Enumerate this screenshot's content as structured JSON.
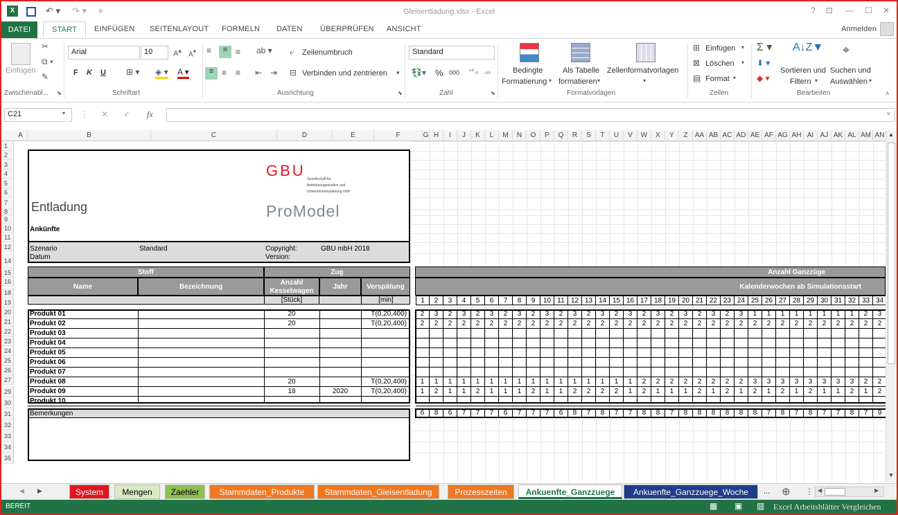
{
  "window": {
    "title": "Gleisentladung.xlsx - Excel",
    "help": "?",
    "min": "—",
    "max": "☐",
    "close": "✕"
  },
  "ribbon_tabs": [
    "DATEI",
    "START",
    "EINFÜGEN",
    "SEITENLAYOUT",
    "FORMELN",
    "DATEN",
    "ÜBERPRÜFEN",
    "ANSICHT"
  ],
  "signin": "Anmelden",
  "ribbon": {
    "clipboard": {
      "paste": "Einfügen",
      "group": "Zwischenabl..."
    },
    "font": {
      "name": "Arial",
      "size": "10",
      "bold": "F",
      "italic": "K",
      "underline": "U",
      "group": "Schriftart"
    },
    "alignment": {
      "wrap": "Zeilenumbruch",
      "merge": "Verbinden und zentrieren",
      "group": "Ausrichtung"
    },
    "number": {
      "format": "Standard",
      "percent": "%",
      "thousands": "000",
      "group": "Zahl"
    },
    "styles": {
      "conditional_1": "Bedingte",
      "conditional_2": "Formatierung",
      "table_1": "Als Tabelle",
      "table_2": "formatieren",
      "cellstyles": "Zellenformatvorlagen",
      "group": "Formatvorlagen"
    },
    "cells": {
      "insert": "Einfügen",
      "delete": "Löschen",
      "format": "Format",
      "group": "Zellen"
    },
    "editing": {
      "sort_1": "Sortieren und",
      "sort_2": "Filtern",
      "find_1": "Suchen und",
      "find_2": "Auswählen",
      "group": "Bearbeiten"
    }
  },
  "formula_bar": {
    "name_box": "C21",
    "fx": "fx",
    "formula": ""
  },
  "columns": [
    "A",
    "B",
    "C",
    "D",
    "E",
    "F",
    "G",
    "H",
    "I",
    "J",
    "K",
    "L",
    "M",
    "N",
    "O",
    "P",
    "Q",
    "R",
    "S",
    "T",
    "U",
    "V",
    "W",
    "X",
    "Y",
    "Z",
    "AA",
    "AB",
    "AC",
    "AD",
    "AE",
    "AF",
    "AG",
    "AH",
    "AI",
    "AJ",
    "AK",
    "AL",
    "AM",
    "AN",
    "AO"
  ],
  "rows": [
    "1",
    "2",
    "3",
    "4",
    "5",
    "6",
    "7",
    "8",
    "9",
    "10",
    "11",
    "12",
    "14",
    "15",
    "16",
    "18",
    "19",
    "20",
    "21",
    "22",
    "23",
    "24",
    "25",
    "26",
    "27",
    "29",
    "30",
    "31",
    "32",
    "33",
    "34",
    "35"
  ],
  "sheet": {
    "title": "Entladung",
    "subtitle": "Ankünfte",
    "gbu_logo": "GBU",
    "gbu_line1": "Gesellschaft für",
    "gbu_line2": "Betriebsorganisation und",
    "gbu_line3": "Unternehmensplanung mbH",
    "promodel_logo": "ProModel",
    "szenario_label": "Szenario",
    "szenario_value": "Standard",
    "datum_label": "Datum",
    "copyright_label": "Copyright:",
    "copyright_value": "GBU mbH 2018",
    "version_label": "Version:",
    "hdr_stoff": "Stoff",
    "hdr_zug": "Zug",
    "hdr_name": "Name",
    "hdr_bez": "Bezeichnung",
    "hdr_anzahl": "Anzahl Kesselwagen",
    "hdr_jahr": "Jahr",
    "hdr_versp": "Verspätung",
    "unit_stueck": "[Stück]",
    "unit_min": "[min]",
    "hdr_ganz": "Anzahl Ganzzüge",
    "hdr_kw": "Kalenderwochen ab Simulationsstart",
    "bemerkungen": "Bemerkungen"
  },
  "products": [
    {
      "name": "Produkt 01",
      "anzahl": "20",
      "jahr": "",
      "versp": "T(0,20,400)"
    },
    {
      "name": "Produkt 02",
      "anzahl": "20",
      "jahr": "",
      "versp": "T(0,20,400)"
    },
    {
      "name": "Produkt 03",
      "anzahl": "",
      "jahr": "",
      "versp": ""
    },
    {
      "name": "Produkt 04",
      "anzahl": "",
      "jahr": "",
      "versp": ""
    },
    {
      "name": "Produkt 05",
      "anzahl": "",
      "jahr": "",
      "versp": ""
    },
    {
      "name": "Produkt 06",
      "anzahl": "",
      "jahr": "",
      "versp": ""
    },
    {
      "name": "Produkt 07",
      "anzahl": "",
      "jahr": "",
      "versp": ""
    },
    {
      "name": "Produkt 08",
      "anzahl": "20",
      "jahr": "",
      "versp": "T(0,20,400)"
    },
    {
      "name": "Produkt 09",
      "anzahl": "18",
      "jahr": "2020",
      "versp": "T(0,20,400)"
    },
    {
      "name": "Produkt 10",
      "anzahl": "",
      "jahr": "",
      "versp": ""
    }
  ],
  "weeks": [
    "1",
    "2",
    "3",
    "4",
    "5",
    "6",
    "7",
    "8",
    "9",
    "10",
    "11",
    "12",
    "13",
    "14",
    "15",
    "16",
    "17",
    "18",
    "19",
    "20",
    "21",
    "22",
    "23",
    "24",
    "25",
    "26",
    "27",
    "28",
    "29",
    "30",
    "31",
    "32",
    "33",
    "34"
  ],
  "week_values": {
    "p01": [
      "2",
      "3",
      "2",
      "3",
      "2",
      "3",
      "2",
      "3",
      "2",
      "3",
      "2",
      "3",
      "2",
      "3",
      "2",
      "3",
      "2",
      "3",
      "2",
      "3",
      "2",
      "3",
      "2",
      "3",
      "1",
      "1",
      "1",
      "1",
      "1",
      "1",
      "1",
      "1",
      "2",
      "3"
    ],
    "p02": [
      "2",
      "2",
      "2",
      "2",
      "2",
      "2",
      "2",
      "2",
      "2",
      "2",
      "2",
      "2",
      "2",
      "2",
      "2",
      "2",
      "2",
      "2",
      "2",
      "2",
      "2",
      "2",
      "2",
      "2",
      "2",
      "2",
      "2",
      "2",
      "2",
      "2",
      "2",
      "2",
      "2",
      "2"
    ],
    "p08": [
      "1",
      "1",
      "1",
      "1",
      "1",
      "1",
      "1",
      "1",
      "1",
      "1",
      "1",
      "1",
      "1",
      "1",
      "1",
      "1",
      "2",
      "2",
      "2",
      "2",
      "2",
      "2",
      "2",
      "2",
      "3",
      "3",
      "3",
      "3",
      "3",
      "3",
      "3",
      "3",
      "2",
      "2"
    ],
    "p09": [
      "1",
      "2",
      "1",
      "1",
      "2",
      "1",
      "1",
      "1",
      "2",
      "1",
      "1",
      "2",
      "2",
      "2",
      "2",
      "1",
      "2",
      "1",
      "1",
      "1",
      "2",
      "1",
      "2",
      "1",
      "2",
      "1",
      "2",
      "1",
      "2",
      "1",
      "1",
      "2",
      "1",
      "2"
    ],
    "sum": [
      "6",
      "8",
      "6",
      "7",
      "7",
      "7",
      "6",
      "7",
      "7",
      "7",
      "6",
      "8",
      "7",
      "8",
      "7",
      "7",
      "8",
      "8",
      "7",
      "8",
      "8",
      "8",
      "8",
      "8",
      "8",
      "7",
      "8",
      "7",
      "8",
      "7",
      "7",
      "8",
      "7",
      "9"
    ]
  },
  "sheet_tabs": [
    {
      "label": "System",
      "bg": "#e0141e",
      "fg": "#ffffff"
    },
    {
      "label": "Mengen",
      "bg": "#d8ebc0",
      "fg": "#000000"
    },
    {
      "label": "Zaehler",
      "bg": "#8cc152",
      "fg": "#000000"
    },
    {
      "label": "Stammdaten_Produkte",
      "bg": "#f07820",
      "fg": "#ffffff"
    },
    {
      "label": "Stammdaten_Gleisentladung",
      "bg": "#f07820",
      "fg": "#ffffff"
    },
    {
      "label": "Prozesszeiten",
      "bg": "#f07820",
      "fg": "#ffffff"
    },
    {
      "label": "Ankuenfte_Ganzzuege",
      "bg": "#ffffff",
      "fg": "#217346"
    },
    {
      "label": "Ankuenfte_Ganzzuege_Woche",
      "bg": "#1f3c88",
      "fg": "#ffffff"
    }
  ],
  "tabs_more": "...",
  "status": {
    "ready": "BEREIT",
    "watermark": "Excel Arbeitsblätter Vergleichen"
  }
}
